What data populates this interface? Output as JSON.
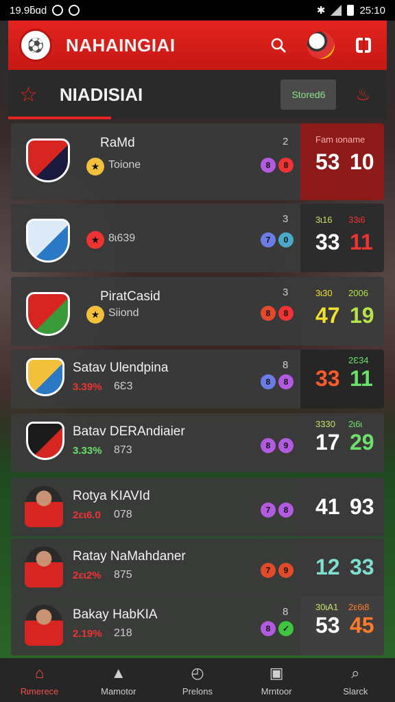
{
  "status_bar": {
    "time": "19.9ƃɑd",
    "clock": "25:10"
  },
  "header": {
    "title": "NAHAINGIAI",
    "logo": "club-logo",
    "search_icon": "search-icon",
    "menu_icon": "grid-icon"
  },
  "subheader": {
    "title": "NIADISIAI",
    "sort_label": "Stored6",
    "star_icon": "star-icon",
    "fire_icon": "fire-icon"
  },
  "accent": "#e3241f",
  "rows": [
    {
      "name": "RaMd",
      "sub": "Toione",
      "pct": "",
      "pct_color": "#e33",
      "index": "2",
      "badges": [
        {
          "glyph": "8",
          "color": "#b25be0"
        },
        {
          "glyph": "8",
          "color": "#e33"
        }
      ],
      "score_labels": [
        "Fam ɩoname",
        ""
      ],
      "scores": [
        "53",
        "10"
      ],
      "score_colors": [
        "#ffffff",
        "#ffffff"
      ],
      "label_colors": [
        "#ffb0b0",
        "#ffb0b0"
      ],
      "box": "#8c1a18",
      "avatar": "crest",
      "crest_colors": [
        "#d72622",
        "#1a1a40"
      ]
    },
    {
      "name": "",
      "sub": "8ɩ639",
      "pct": "",
      "pct_color": "#e33",
      "index": "3",
      "badges": [
        {
          "glyph": "7",
          "color": "#6a7de6"
        },
        {
          "glyph": "0",
          "color": "#4aa8c9"
        }
      ],
      "score_labels": [
        "3ɩ16",
        "33ɩ6"
      ],
      "scores": [
        "33",
        "11"
      ],
      "score_colors": [
        "#ffffff",
        "#e33"
      ],
      "label_colors": [
        "#c5e06b",
        "#e33"
      ],
      "box": "#2c2c2c",
      "avatar": "crest",
      "crest_colors": [
        "#dce9f7",
        "#2b78c5"
      ]
    },
    {
      "name": "PiratCasid",
      "sub": "Siiond",
      "pct": "",
      "pct_color": "#e33",
      "index": "3",
      "badges": [
        {
          "glyph": "8",
          "color": "#e24a2a"
        },
        {
          "glyph": "8",
          "color": "#e33"
        }
      ],
      "score_labels": [
        "3ɩ30",
        "2006"
      ],
      "scores": [
        "47",
        "19"
      ],
      "score_colors": [
        "#f0e030",
        "#b6e34a"
      ],
      "label_colors": [
        "#f0e030",
        "#b6e34a"
      ],
      "box": "#3a3a3a",
      "avatar": "crest",
      "crest_colors": [
        "#d72622",
        "#3a9a3a"
      ]
    },
    {
      "name": "Satav Ulendpina",
      "sub": "6Ɛ3",
      "pct": "3.39%",
      "pct_color": "#e33",
      "index": "8",
      "badges": [
        {
          "glyph": "8",
          "color": "#6a7de6"
        },
        {
          "glyph": "8",
          "color": "#b25be0"
        }
      ],
      "score_labels": [
        "",
        "2Ɛ34"
      ],
      "scores": [
        "33",
        "11"
      ],
      "score_colors": [
        "#ff5a2a",
        "#6be06b"
      ],
      "label_colors": [
        "#6be06b",
        "#6be06b"
      ],
      "box": "#262626",
      "avatar": "crest",
      "crest_colors": [
        "#f2c03a",
        "#2b78c5"
      ]
    },
    {
      "name": "Batav DERAndiaier",
      "sub": "873",
      "pct": "3.33%",
      "pct_color": "#6be06b",
      "index": "",
      "badges": [
        {
          "glyph": "8",
          "color": "#b25be0"
        },
        {
          "glyph": "9",
          "color": "#b25be0"
        }
      ],
      "score_labels": [
        "3330",
        "2ɩ6ɩ"
      ],
      "scores": [
        "17",
        "29"
      ],
      "score_colors": [
        "#ffffff",
        "#6be06b"
      ],
      "label_colors": [
        "#c5e06b",
        "#6be06b"
      ],
      "box": "#3a3a3a",
      "avatar": "crest",
      "crest_colors": [
        "#1a1a1a",
        "#d72622"
      ]
    },
    {
      "name": "Rotya KIAVId",
      "sub": "078",
      "pct": "2ɛɩ6.0",
      "pct_color": "#e33",
      "index": "",
      "badges": [
        {
          "glyph": "7",
          "color": "#b25be0"
        },
        {
          "glyph": "8",
          "color": "#b25be0"
        }
      ],
      "score_labels": [
        "",
        ""
      ],
      "scores": [
        "41",
        "93"
      ],
      "score_colors": [
        "#ffffff",
        "#ffffff"
      ],
      "label_colors": [
        "#ffffff",
        "#ffffff"
      ],
      "box": "#3a3a3a",
      "avatar": "player",
      "crest_colors": [
        "#d72622",
        "#222"
      ]
    },
    {
      "name": "Ratay NaMahdaner",
      "sub": "875",
      "pct": "2ɛɩ2%",
      "pct_color": "#e33",
      "index": "",
      "badges": [
        {
          "glyph": "7",
          "color": "#e24a2a"
        },
        {
          "glyph": "9",
          "color": "#e24a2a"
        }
      ],
      "score_labels": [
        "",
        ""
      ],
      "scores": [
        "12",
        "33"
      ],
      "score_colors": [
        "#7de0d0",
        "#7de0d0"
      ],
      "label_colors": [
        "#7de0d0",
        "#7de0d0"
      ],
      "box": "#3a3a3a",
      "avatar": "player",
      "crest_colors": [
        "#2b78c5",
        "#d72622"
      ]
    },
    {
      "name": "Bakay HabKIA",
      "sub": "218",
      "pct": "2.19%",
      "pct_color": "#e33",
      "index": "8",
      "badges": [
        {
          "glyph": "8",
          "color": "#b25be0"
        },
        {
          "glyph": "✓",
          "color": "#3ec43e"
        }
      ],
      "score_labels": [
        "30ɩA1",
        "2ɛ6ɩ8"
      ],
      "scores": [
        "53",
        "45"
      ],
      "score_colors": [
        "#ffffff",
        "#ff7a2a"
      ],
      "label_colors": [
        "#c5e06b",
        "#ff7a2a"
      ],
      "box": "#3f3f3f",
      "avatar": "player",
      "crest_colors": [
        "#d72622",
        "#222"
      ]
    }
  ],
  "nav": [
    {
      "label": "Rɩmerece",
      "icon": "home-icon",
      "glyph": "⌂",
      "active": true
    },
    {
      "label": "Mamotor",
      "icon": "store-icon",
      "glyph": "▲",
      "active": false
    },
    {
      "label": "Prelons",
      "icon": "compass-icon",
      "glyph": "◴",
      "active": false
    },
    {
      "label": "Mrntoor",
      "icon": "monitor-icon",
      "glyph": "▣",
      "active": false
    },
    {
      "label": "Slarck",
      "icon": "search-icon",
      "glyph": "⌕",
      "active": false
    }
  ]
}
